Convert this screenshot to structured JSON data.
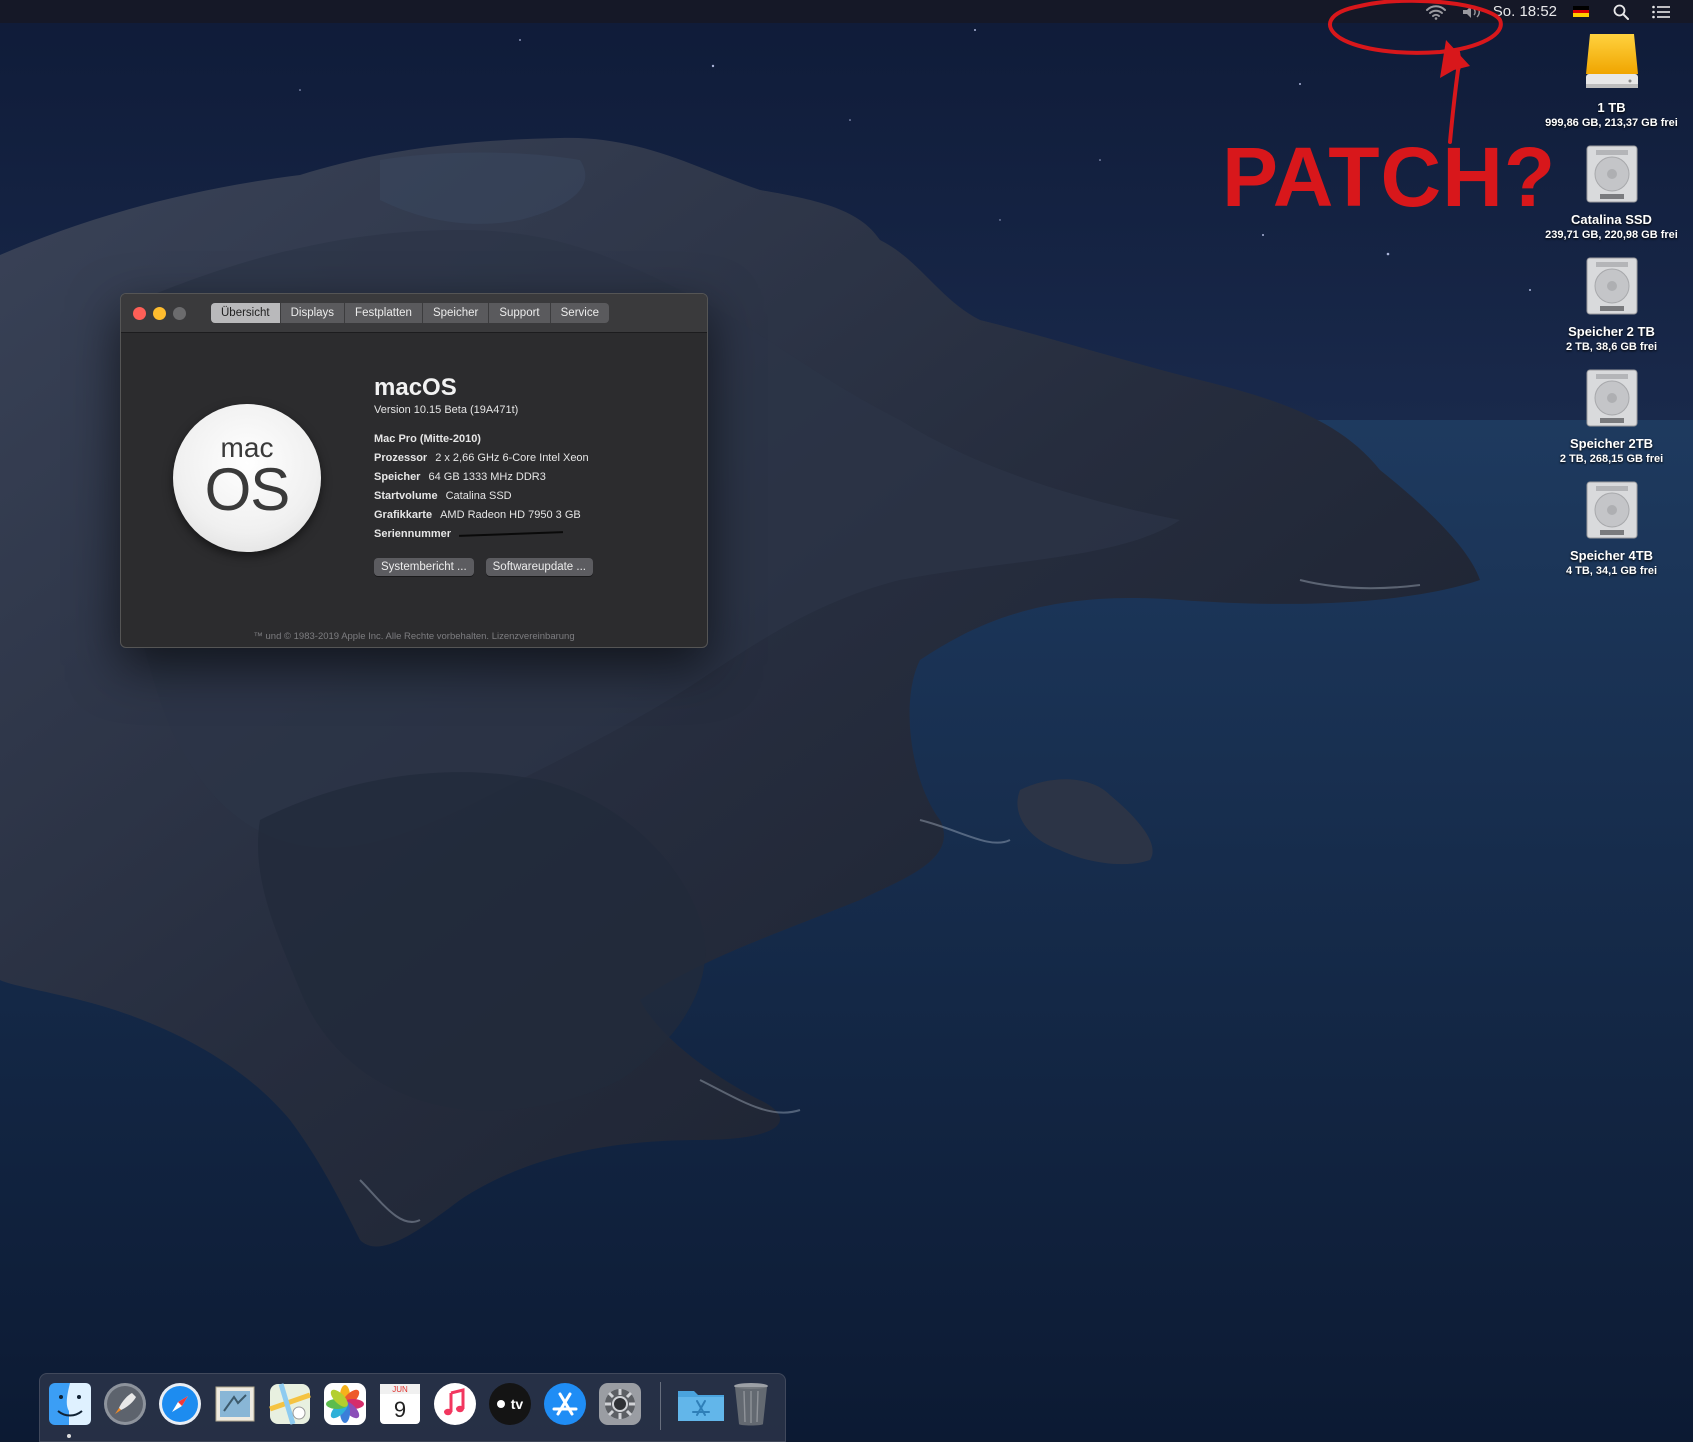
{
  "menubar": {
    "clock": "So. 18:52",
    "icons": [
      "wifi-icon",
      "volume-icon",
      "german-flag-icon",
      "spotlight-search-icon",
      "notification-center-icon"
    ]
  },
  "annotation": {
    "text": "PATCH?",
    "color": "#d8171b"
  },
  "desktop_icons": [
    {
      "name": "1 TB",
      "info": "999,86 GB, 213,37 GB frei",
      "type": "external-drive"
    },
    {
      "name": "Catalina SSD",
      "info": "239,71 GB, 220,98 GB frei",
      "type": "internal-drive"
    },
    {
      "name": "Speicher 2 TB",
      "info": "2 TB, 38,6 GB frei",
      "type": "internal-drive"
    },
    {
      "name": "Speicher 2TB",
      "info": "2 TB, 268,15 GB frei",
      "type": "internal-drive"
    },
    {
      "name": "Speicher 4TB",
      "info": "4 TB, 34,1 GB frei",
      "type": "internal-drive"
    }
  ],
  "about_window": {
    "tabs": [
      "Übersicht",
      "Displays",
      "Festplatten",
      "Speicher",
      "Support",
      "Service"
    ],
    "active_tab": "Übersicht",
    "logo": {
      "top": "mac",
      "bottom": "OS"
    },
    "os_name": "macOS",
    "version": "Version 10.15 Beta (19A471t)",
    "model": "Mac Pro (Mitte-2010)",
    "specs": [
      {
        "label": "Prozessor",
        "value": "2 x 2,66 GHz 6-Core Intel Xeon"
      },
      {
        "label": "Speicher",
        "value": "64 GB 1333 MHz DDR3"
      },
      {
        "label": "Startvolume",
        "value": "Catalina SSD"
      },
      {
        "label": "Grafikkarte",
        "value": "AMD Radeon HD 7950 3 GB"
      },
      {
        "label": "Seriennummer",
        "value": ""
      }
    ],
    "buttons": [
      "Systembericht ...",
      "Softwareupdate ..."
    ],
    "footer": "™ und © 1983-2019 Apple Inc. Alle Rechte vorbehalten. Lizenzvereinbarung"
  },
  "dock": {
    "items": [
      "finder-icon",
      "launchpad-icon",
      "safari-icon",
      "mail-icon",
      "maps-icon",
      "photos-icon",
      "calendar-icon",
      "music-icon",
      "apple-tv-icon",
      "app-store-icon",
      "system-preferences-icon",
      "applications-folder-icon",
      "trash-icon"
    ],
    "calendar": {
      "month": "JUN",
      "day": "9"
    },
    "tv_label": "tv"
  }
}
